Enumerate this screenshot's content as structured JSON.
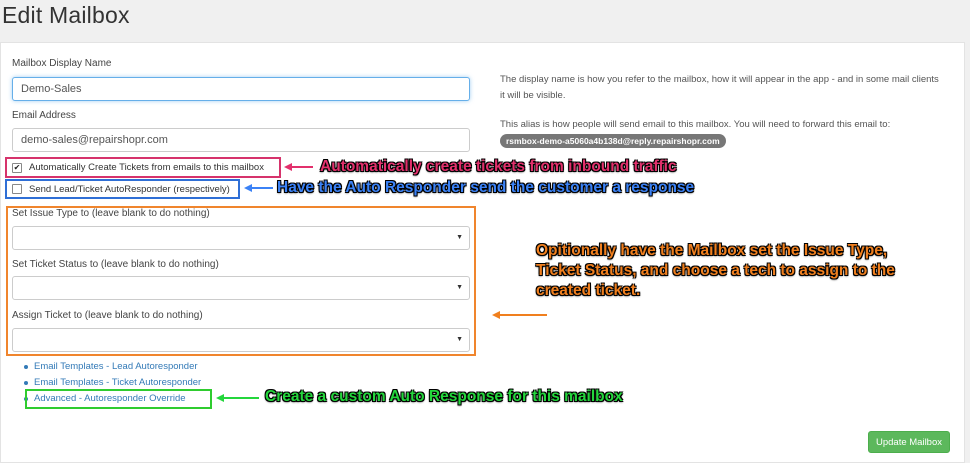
{
  "page": {
    "title": "Edit Mailbox"
  },
  "form": {
    "display_name_label": "Mailbox Display Name",
    "display_name_value": "Demo-Sales",
    "display_name_help": "The display name is how you refer to the mailbox, how it will appear in the app - and in some mail clients it will be visible.",
    "email_label": "Email Address",
    "email_value": "demo-sales@repairshopr.com",
    "email_help": "This alias is how people will send email to this mailbox. You will need to forward this email to:",
    "forward_alias": "rsmbox-demo-a5060a4b138d@reply.repairshopr.com",
    "auto_create_label": "Automatically Create Tickets from emails to this mailbox",
    "auto_create_checked": true,
    "autoresponder_label": "Send Lead/Ticket AutoResponder (respectively)",
    "autoresponder_checked": false,
    "issue_type_label": "Set Issue Type to (leave blank to do nothing)",
    "issue_type_value": "",
    "ticket_status_label": "Set Ticket Status to (leave blank to do nothing)",
    "ticket_status_value": "",
    "assign_ticket_label": "Assign Ticket to (leave blank to do nothing)",
    "assign_ticket_value": ""
  },
  "links": [
    {
      "label": "Email Templates - Lead Autoresponder"
    },
    {
      "label": "Email Templates - Ticket Autoresponder"
    },
    {
      "label": "Advanced - Autoresponder Override"
    }
  ],
  "annotations": {
    "auto_create": "Automatically create tickets from inbound traffic",
    "autoresponder": "Have the Auto Responder send the customer a response",
    "options_line1": "Opitionally have the Mailbox set the Issue Type,",
    "options_line2": "Ticket Status, and choose a tech to assign to the",
    "options_line3": "created ticket.",
    "override": "Create a custom Auto Response for this mailbox"
  },
  "update_button_label": "Update Mailbox",
  "colors": {
    "pink": "#e2306c",
    "blue": "#3b82f6",
    "orange": "#f07f1e",
    "green": "#24d63c",
    "button": "#5cb85c",
    "link": "#337ab7"
  }
}
